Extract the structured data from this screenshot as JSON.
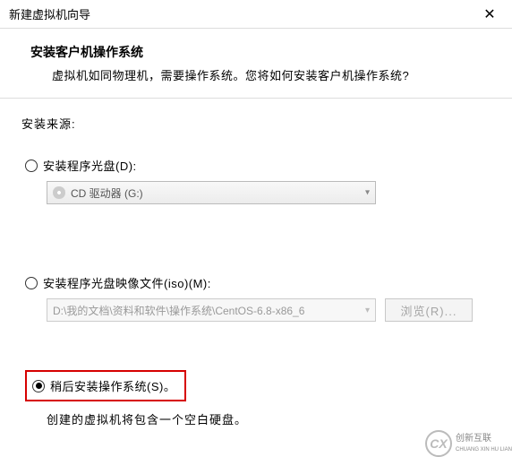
{
  "window": {
    "title": "新建虚拟机向导",
    "close": "✕"
  },
  "header": {
    "title": "安装客户机操作系统",
    "desc": "虚拟机如同物理机，需要操作系统。您将如何安装客户机操作系统?"
  },
  "source_label": "安装来源:",
  "option_disc": {
    "label": "安装程序光盘(D):",
    "drive": "CD 驱动器 (G:)"
  },
  "option_iso": {
    "label": "安装程序光盘映像文件(iso)(M):",
    "path": "D:\\我的文档\\资料和软件\\操作系统\\CentOS-6.8-x86_6",
    "browse": "浏览(R)..."
  },
  "option_later": {
    "label": "稍后安装操作系统(S)。",
    "hint": "创建的虚拟机将包含一个空白硬盘。"
  },
  "watermark": {
    "logo": "CX",
    "line1": "创新互联",
    "line2": "CHUANG XIN HU LIAN"
  }
}
